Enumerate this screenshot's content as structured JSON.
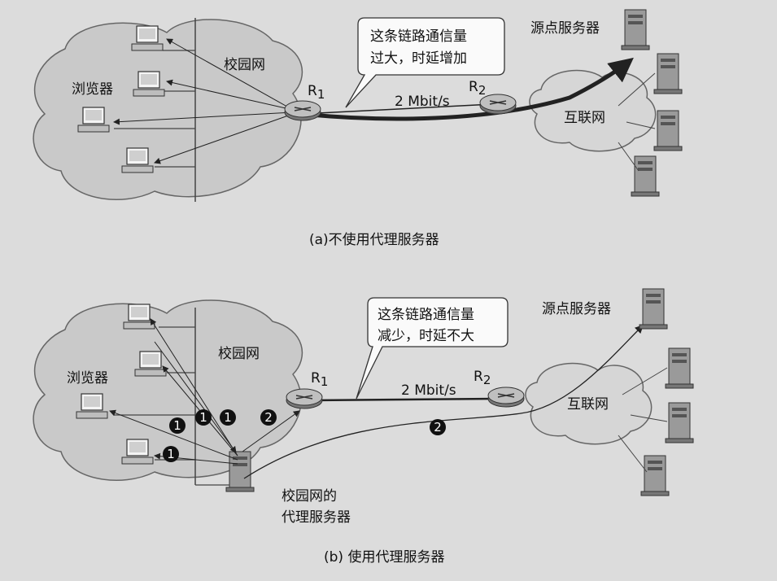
{
  "diagram_a": {
    "caption": "(a)不使用代理服务器",
    "campus": "校园网",
    "browser": "浏览器",
    "r1": "R",
    "r1_sub": "1",
    "r2": "R",
    "r2_sub": "2",
    "link": "2 Mbit/s",
    "callout_line1": "这条链路通信量",
    "callout_line2": "过大，时延增加",
    "origin": "源点服务器",
    "internet": "互联网"
  },
  "diagram_b": {
    "caption": "(b) 使用代理服务器",
    "campus": "校园网",
    "browser": "浏览器",
    "r1": "R",
    "r1_sub": "1",
    "r2": "R",
    "r2_sub": "2",
    "link": "2 Mbit/s",
    "callout_line1": "这条链路通信量",
    "callout_line2": "减少，时延不大",
    "origin": "源点服务器",
    "internet": "互联网",
    "proxy_line1": "校园网的",
    "proxy_line2": "代理服务器",
    "step1": "1",
    "step2": "2"
  }
}
